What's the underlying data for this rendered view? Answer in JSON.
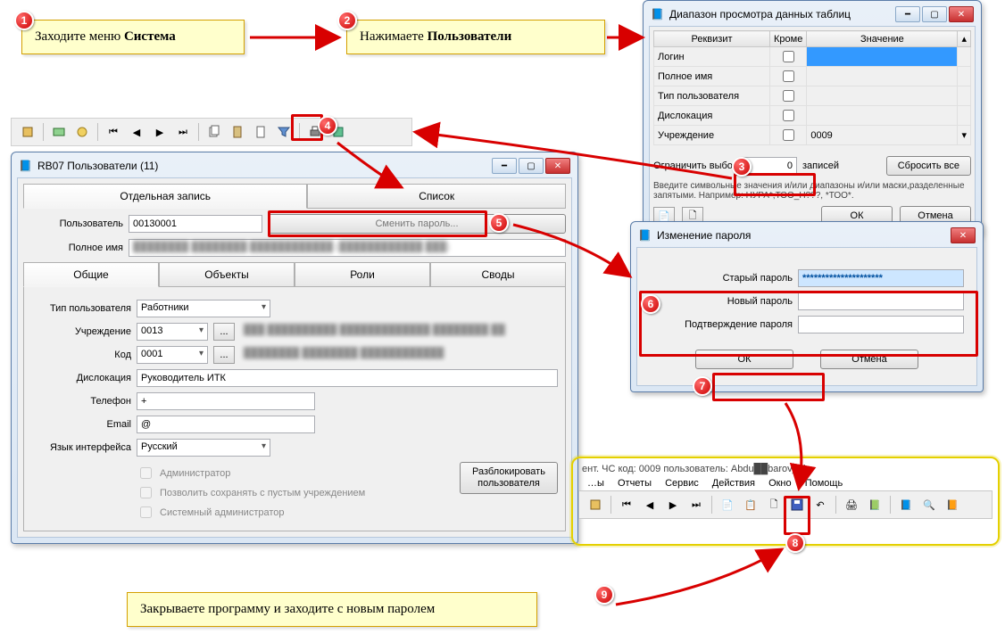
{
  "callouts": {
    "step1_a": "Заходите меню ",
    "step1_b": "Система",
    "step2_a": "Нажимаете ",
    "step2_b": "Пользователи",
    "step9": "Закрываете программу и заходите с новым паролем"
  },
  "markers": [
    "1",
    "2",
    "3",
    "4",
    "5",
    "6",
    "7",
    "8",
    "9"
  ],
  "range_dialog": {
    "title": "Диапазон просмотра данных таблиц",
    "cols": {
      "rekvizit": "Реквизит",
      "krome": "Кроме",
      "znach": "Значение"
    },
    "rows": [
      {
        "name": "Логин",
        "krome": false,
        "val": ""
      },
      {
        "name": "Полное имя",
        "krome": false,
        "val": ""
      },
      {
        "name": "Тип пользователя",
        "krome": false,
        "val": ""
      },
      {
        "name": "Дислокация",
        "krome": false,
        "val": ""
      },
      {
        "name": "Учреждение",
        "krome": false,
        "val": "0009"
      }
    ],
    "limit_label": "Ограничить выбор",
    "limit_value": "0",
    "limit_suffix": "записей",
    "reset": "Сбросить все",
    "hint": "Введите символьные значения и/или диапазоны и/или маски,разделенные запятыми. Например: НУРА*,ТОО_Н???,  *ТОО*.",
    "ok": "ОК",
    "cancel": "Отмена"
  },
  "rb07": {
    "title": "RB07 Пользователи (11)",
    "tab_single": "Отдельная запись",
    "tab_list": "Список",
    "user_label": "Пользователь",
    "user_val": "00130001",
    "change_pw": "Сменить пароль...",
    "fullname_label": "Полное имя",
    "fullname_val": "████████ ████████ ████████████ (████████████ ███)",
    "tabs": {
      "general": "Общие",
      "objects": "Объекты",
      "roles": "Роли",
      "svody": "Своды"
    },
    "type_label": "Тип пользователя",
    "type_val": "Работники",
    "org_label": "Учреждение",
    "org_val": "0013",
    "org_desc": "███ ██████████ █████████████ ████████ ██",
    "code_label": "Код",
    "code_val": "0001",
    "code_desc": "████████ ████████ ████████████",
    "disloc_label": "Дислокация",
    "disloc_val": "Руководитель ИТК",
    "phone_label": "Телефон",
    "phone_val": "+",
    "email_label": "Email",
    "email_val": "@",
    "lang_label": "Язык интерфейса",
    "lang_val": "Русский",
    "chk_admin": "Администратор",
    "chk_empty_org": "Позволить сохранять с пустым учреждением",
    "chk_sysadmin": "Системный администратор",
    "unblock": "Разблокировать пользователя"
  },
  "pw_dialog": {
    "title": "Изменение пароля",
    "old_label": "Старый пароль",
    "old_val": "*********************",
    "new_label": "Новый пароль",
    "confirm_label": "Подтверждение пароля",
    "ok": "ОК",
    "cancel": "Отмена"
  },
  "bottom_toolbar": {
    "title_frag": "ент. ЧС код: 0009 пользователь: Abdu██barov_Z)",
    "menu": {
      "reports": "Отчеты",
      "service": "Сервис",
      "actions": "Действия",
      "window": "Окно",
      "help": "Помощь"
    }
  }
}
